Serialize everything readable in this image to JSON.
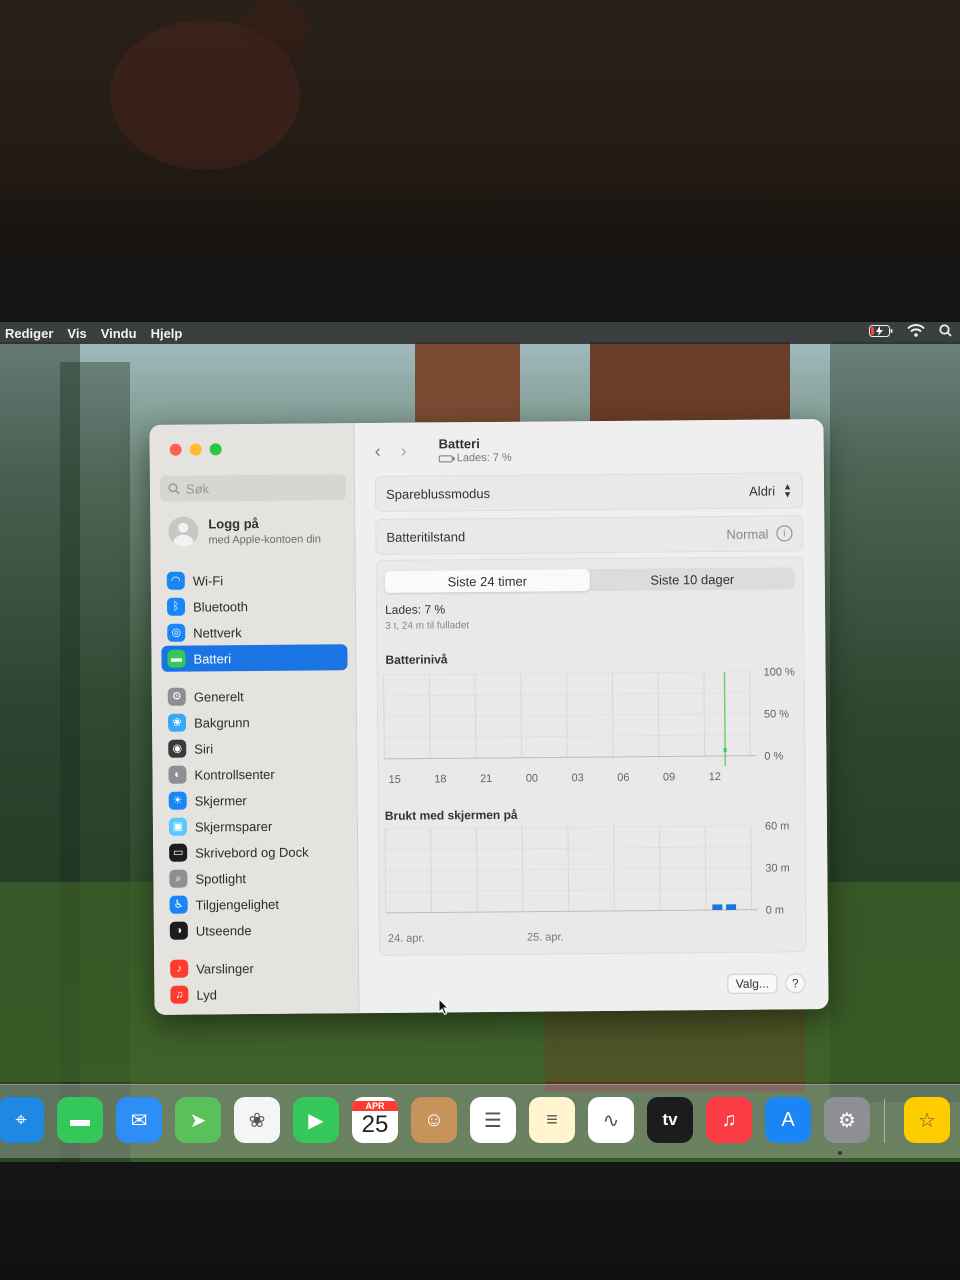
{
  "menubar": {
    "items": [
      "Rediger",
      "Vis",
      "Vindu",
      "Hjelp"
    ]
  },
  "sidebar": {
    "search_placeholder": "Søk",
    "account": {
      "title": "Logg på",
      "subtitle": "med Apple-kontoen din"
    },
    "groups": [
      [
        {
          "label": "Wi-Fi",
          "icon": "wifi-icon",
          "color": "#1a86f5"
        },
        {
          "label": "Bluetooth",
          "icon": "bluetooth-icon",
          "color": "#1a86f5"
        },
        {
          "label": "Nettverk",
          "icon": "globe-icon",
          "color": "#1a86f5"
        },
        {
          "label": "Batteri",
          "icon": "battery-icon",
          "color": "#34c759",
          "active": true
        }
      ],
      [
        {
          "label": "Generelt",
          "icon": "gear-icon",
          "color": "#8e8e93"
        },
        {
          "label": "Bakgrunn",
          "icon": "flower-icon",
          "color": "#35aaf5"
        },
        {
          "label": "Siri",
          "icon": "siri-icon",
          "color": "#3a3a3c"
        },
        {
          "label": "Kontrollsenter",
          "icon": "toggle-icon",
          "color": "#8e8e93"
        },
        {
          "label": "Skjermer",
          "icon": "sun-icon",
          "color": "#1a86f5"
        },
        {
          "label": "Skjermsparer",
          "icon": "screensaver-icon",
          "color": "#5ac8fa"
        },
        {
          "label": "Skrivebord og Dock",
          "icon": "dock-icon",
          "color": "#1c1c1e"
        },
        {
          "label": "Spotlight",
          "icon": "magnifier-icon",
          "color": "#8e8e93"
        },
        {
          "label": "Tilgjengelighet",
          "icon": "accessibility-icon",
          "color": "#1a86f5"
        },
        {
          "label": "Utseende",
          "icon": "appearance-icon",
          "color": "#1c1c1e"
        }
      ],
      [
        {
          "label": "Varslinger",
          "icon": "bell-icon",
          "color": "#ff3b30"
        },
        {
          "label": "Lyd",
          "icon": "speaker-icon",
          "color": "#ff3b30"
        }
      ]
    ]
  },
  "main": {
    "title": "Batteri",
    "subtitle": "Lades: 7 %",
    "low_power": {
      "label": "Spareblussmodus",
      "value": "Aldri"
    },
    "health": {
      "label": "Batteritilstand",
      "value": "Normal"
    },
    "tabs": [
      "Siste 24 timer",
      "Siste 10 dager"
    ],
    "charge_status": "Lades: 7 %",
    "charge_time": "3 t, 24 m til fulladet",
    "battery_chart_title": "Batterinivå",
    "screen_chart_title": "Brukt med skjermen på",
    "dates": [
      "24. apr.",
      "25. apr."
    ],
    "options_button": "Valg...",
    "help_button": "?"
  },
  "chart_data": [
    {
      "type": "line",
      "title": "Batterinivå",
      "x": [
        "15",
        "18",
        "21",
        "00",
        "03",
        "06",
        "09",
        "12"
      ],
      "y_ticks": [
        "100 %",
        "50 %",
        "0 %"
      ],
      "ylim": [
        0,
        100
      ],
      "series": [
        {
          "values": [
            null,
            null,
            null,
            null,
            null,
            null,
            null,
            7
          ]
        }
      ],
      "charging_indicator_hour_index": 7.45
    },
    {
      "type": "bar",
      "title": "Brukt med skjermen på",
      "x": [
        "15",
        "18",
        "21",
        "00",
        "03",
        "06",
        "09",
        "12"
      ],
      "y_ticks": [
        "60 m",
        "30 m",
        "0 m"
      ],
      "ylim": [
        0,
        60
      ],
      "bars": [
        {
          "hour_index": 7.25,
          "value": 4
        },
        {
          "hour_index": 7.55,
          "value": 4
        }
      ]
    }
  ],
  "dock": {
    "apps": [
      {
        "name": "safari-icon",
        "color": "#1e88e5"
      },
      {
        "name": "messages-icon",
        "color": "#34c759"
      },
      {
        "name": "mail-icon",
        "color": "#2f8ef5"
      },
      {
        "name": "maps-icon",
        "color": "#5ac05a"
      },
      {
        "name": "photos-icon",
        "color": "#f5f5f5"
      },
      {
        "name": "facetime-icon",
        "color": "#34c759"
      },
      {
        "name": "calendar-icon",
        "color": "#ffffff",
        "month": "APR",
        "day": "25"
      },
      {
        "name": "contacts-icon",
        "color": "#c7935a"
      },
      {
        "name": "reminders-icon",
        "color": "#ffffff"
      },
      {
        "name": "notes-icon",
        "color": "#fff6d0"
      },
      {
        "name": "freeform-icon",
        "color": "#ffffff"
      },
      {
        "name": "appletv-icon",
        "color": "#1c1c1e",
        "label": "tv"
      },
      {
        "name": "music-icon",
        "color": "#fc3c44"
      },
      {
        "name": "appstore-icon",
        "color": "#1a86f5"
      },
      {
        "name": "system-settings-icon",
        "color": "#8e8e93"
      },
      {
        "name": "tips-icon",
        "color": "#ffcc00"
      }
    ]
  }
}
